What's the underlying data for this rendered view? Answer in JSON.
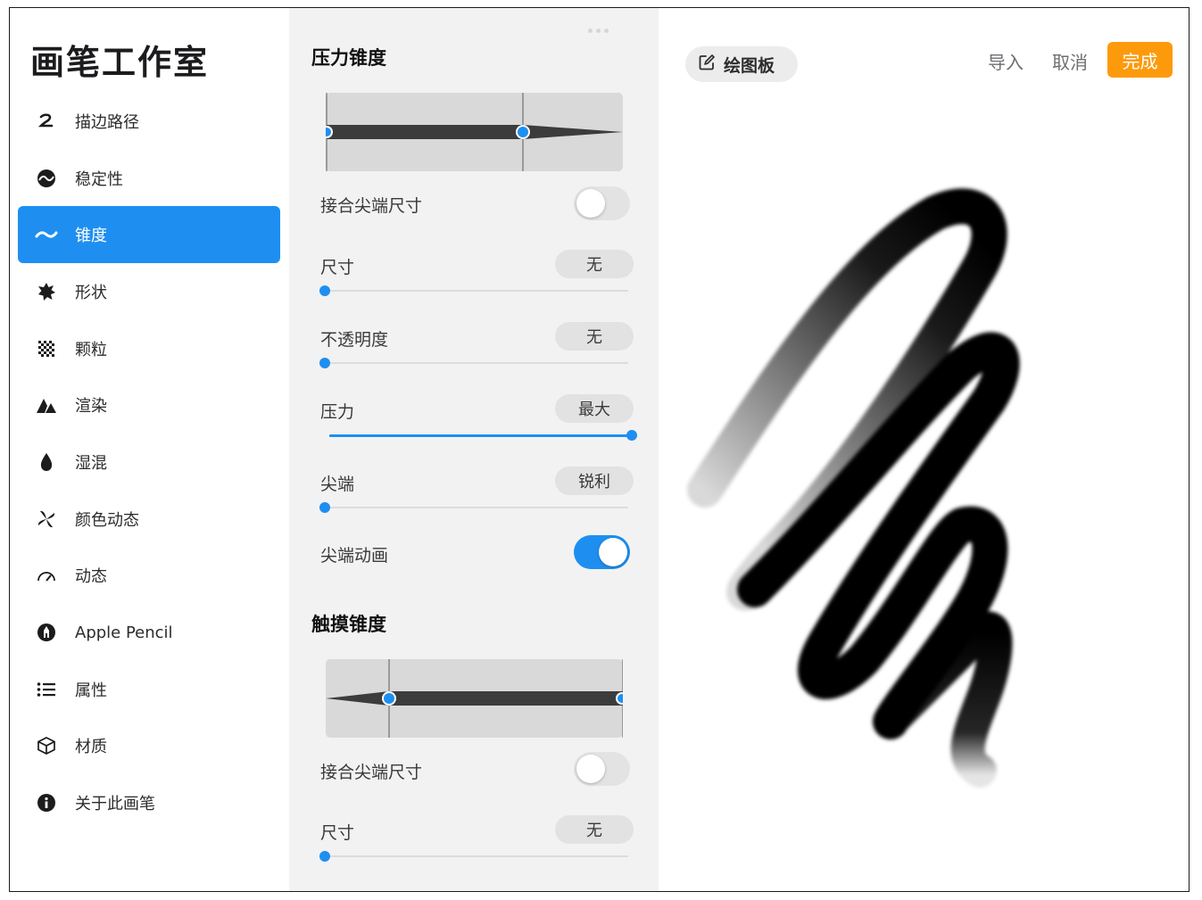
{
  "app": {
    "title": "画笔工作室"
  },
  "sidebar": {
    "items": [
      {
        "label": "描边路径",
        "icon": "stroke-path-icon",
        "active": false
      },
      {
        "label": "稳定性",
        "icon": "stabilization-icon",
        "active": false
      },
      {
        "label": "锥度",
        "icon": "taper-icon",
        "active": true
      },
      {
        "label": "形状",
        "icon": "shape-icon",
        "active": false
      },
      {
        "label": "颗粒",
        "icon": "grain-icon",
        "active": false
      },
      {
        "label": "渲染",
        "icon": "rendering-icon",
        "active": false
      },
      {
        "label": "湿混",
        "icon": "wet-mix-icon",
        "active": false
      },
      {
        "label": "颜色动态",
        "icon": "color-dynamics-icon",
        "active": false
      },
      {
        "label": "动态",
        "icon": "dynamics-icon",
        "active": false
      },
      {
        "label": "Apple Pencil",
        "icon": "apple-pencil-icon",
        "active": false
      },
      {
        "label": "属性",
        "icon": "properties-icon",
        "active": false
      },
      {
        "label": "材质",
        "icon": "materials-icon",
        "active": false
      },
      {
        "label": "关于此画笔",
        "icon": "info-icon",
        "active": false
      }
    ]
  },
  "pressure_taper": {
    "title": "压力锥度",
    "tip_size_link_label": "接合尖端尺寸",
    "tip_size_link_on": false,
    "size": {
      "label": "尺寸",
      "value": "无",
      "level": 0
    },
    "opacity": {
      "label": "不透明度",
      "value": "无",
      "level": 0
    },
    "pressure": {
      "label": "压力",
      "value": "最大",
      "level": 1
    },
    "tip": {
      "label": "尖端",
      "value": "锐利",
      "level": 0
    },
    "tip_animation_label": "尖端动画",
    "tip_animation_on": true
  },
  "touch_taper": {
    "title": "触摸锥度",
    "tip_size_link_label": "接合尖端尺寸",
    "tip_size_link_on": false,
    "size": {
      "label": "尺寸",
      "value": "无",
      "level": 0
    }
  },
  "canvas": {
    "drawing_pad_label": "绘图板",
    "import_label": "导入",
    "cancel_label": "取消",
    "done_label": "完成"
  },
  "colors": {
    "accent": "#1e8ff0",
    "done": "#fd9a0b",
    "panel": "#f2f2f2"
  }
}
